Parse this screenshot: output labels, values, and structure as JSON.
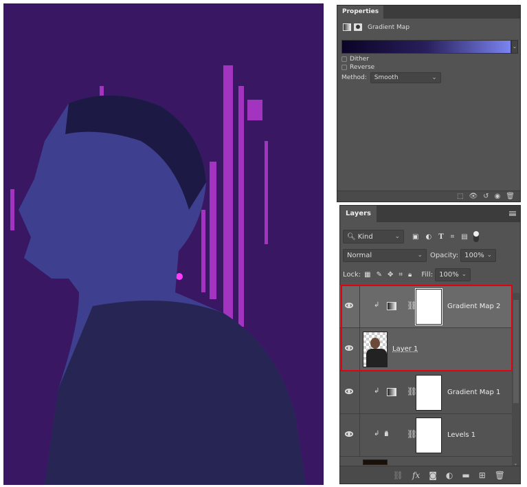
{
  "properties": {
    "tab": "Properties",
    "adjustment": "Gradient Map",
    "gradient_colors": [
      "#0c0327",
      "#281f5b",
      "#7b84f0"
    ],
    "dither_label": "Dither",
    "dither": false,
    "reverse_label": "Reverse",
    "reverse": false,
    "method_label": "Method:",
    "method_value": "Smooth"
  },
  "layers": {
    "tab": "Layers",
    "filter_kind": "Kind",
    "blend_mode": "Normal",
    "opacity_label": "Opacity:",
    "opacity": "100%",
    "lock_label": "Lock:",
    "fill_label": "Fill:",
    "fill": "100%",
    "items": [
      {
        "name": "Gradient Map 2",
        "type": "gradient-map",
        "visible": true,
        "selected": true
      },
      {
        "name": "Layer 1",
        "type": "pixel",
        "visible": true,
        "selected": true
      },
      {
        "name": "Gradient Map 1",
        "type": "gradient-map",
        "visible": true
      },
      {
        "name": "Levels 1",
        "type": "levels",
        "visible": true
      }
    ],
    "highlight_color": "#e3000f"
  },
  "canvas": {
    "background": "#3a1763",
    "accent": "#d23fe6",
    "figure": "#3f3f8c"
  }
}
